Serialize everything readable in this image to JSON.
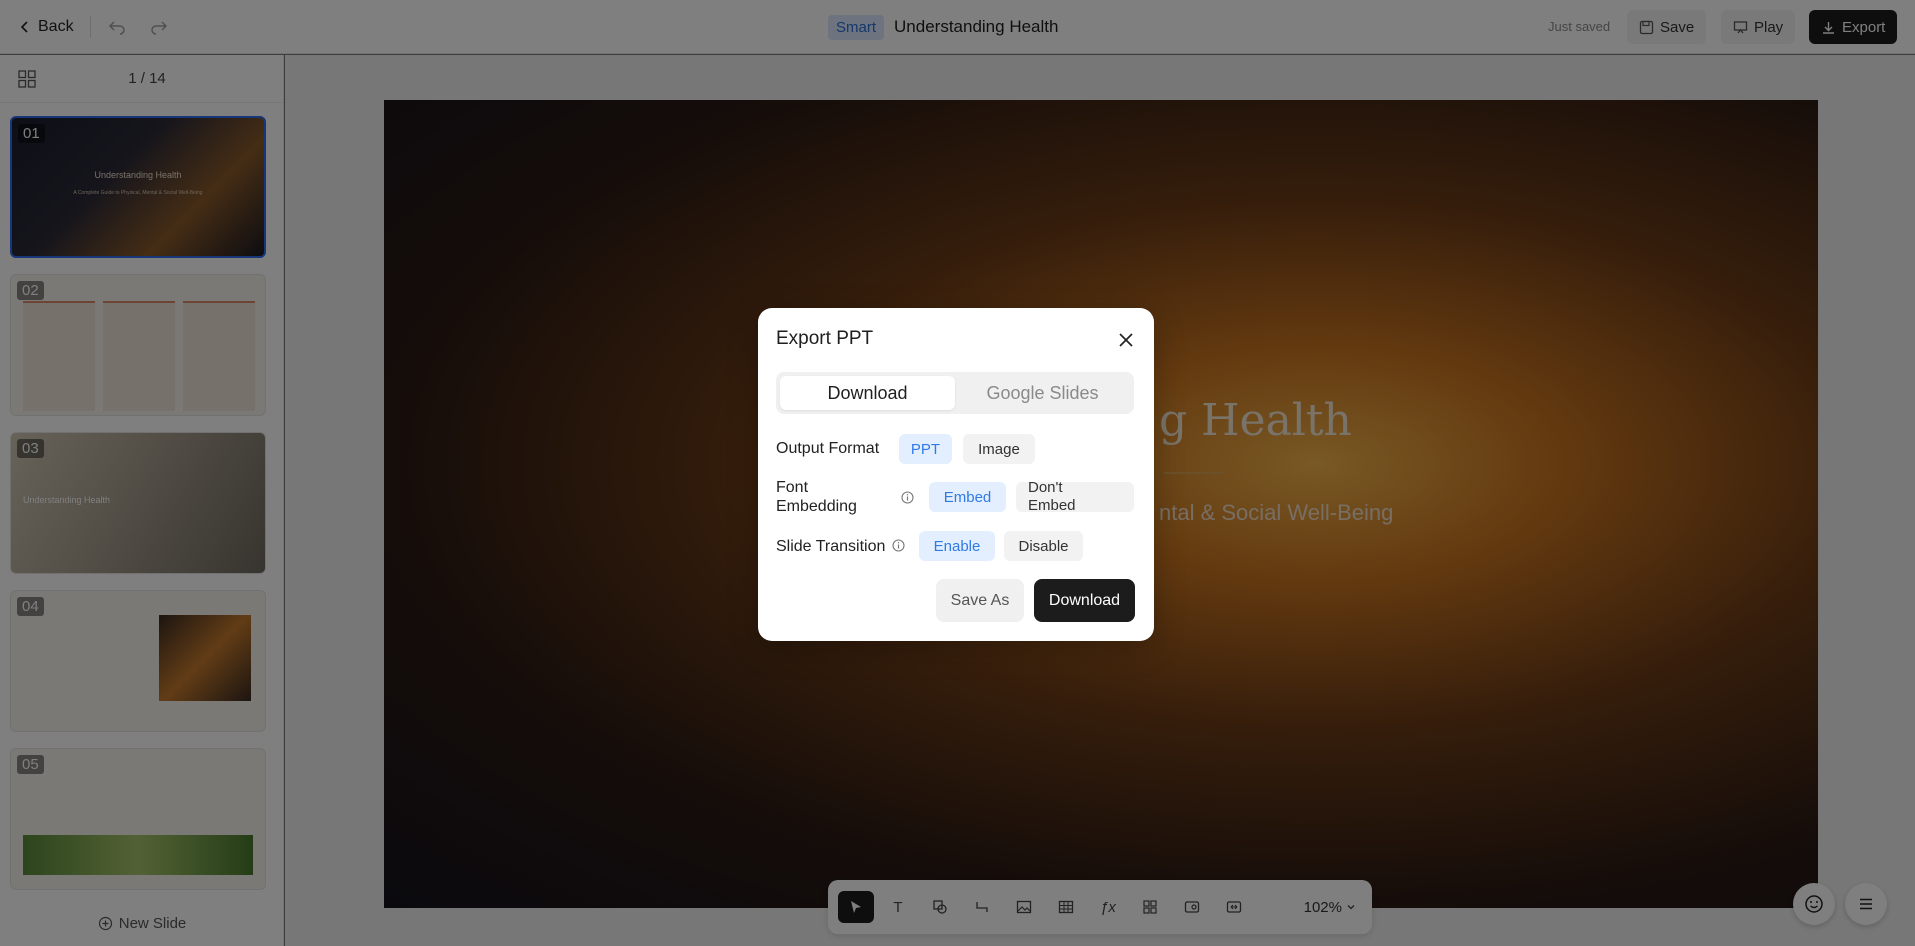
{
  "topbar": {
    "back_label": "Back",
    "smart_badge": "Smart",
    "doc_title": "Understanding Health",
    "saved_status": "Just saved",
    "save_label": "Save",
    "play_label": "Play",
    "export_label": "Export"
  },
  "sidebar": {
    "page_count": "1 / 14",
    "new_slide_label": "New Slide",
    "thumbnails": [
      {
        "num": "01",
        "title": "Understanding Health",
        "sub": "A Complete Guide to Physical, Mental & Social Well-Being"
      },
      {
        "num": "02",
        "title": "",
        "sub": ""
      },
      {
        "num": "03",
        "title": "Understanding Health",
        "sub": ""
      },
      {
        "num": "04",
        "title": "",
        "sub": ""
      },
      {
        "num": "05",
        "title": "",
        "sub": ""
      }
    ]
  },
  "slide": {
    "title": "g Health",
    "subtitle": "ntal & Social Well-Being"
  },
  "toolbar": {
    "zoom": "102%"
  },
  "modal": {
    "title": "Export PPT",
    "tabs": [
      "Download",
      "Google Slides"
    ],
    "active_tab": "Download",
    "output_format_label": "Output Format",
    "output_format_options": [
      "PPT",
      "Image"
    ],
    "output_format_selected": "PPT",
    "font_embedding_label": "Font Embedding",
    "font_embedding_options": [
      "Embed",
      "Don't Embed"
    ],
    "font_embedding_selected": "Embed",
    "slide_transition_label": "Slide Transition",
    "slide_transition_options": [
      "Enable",
      "Disable"
    ],
    "slide_transition_selected": "Enable",
    "save_as_label": "Save As",
    "download_label": "Download"
  },
  "colors": {
    "accent": "#2f7ae5",
    "dark_button": "#1c1c1c",
    "selected_chip_bg": "#e3efff",
    "active_thumb_border": "#2f6df2"
  }
}
